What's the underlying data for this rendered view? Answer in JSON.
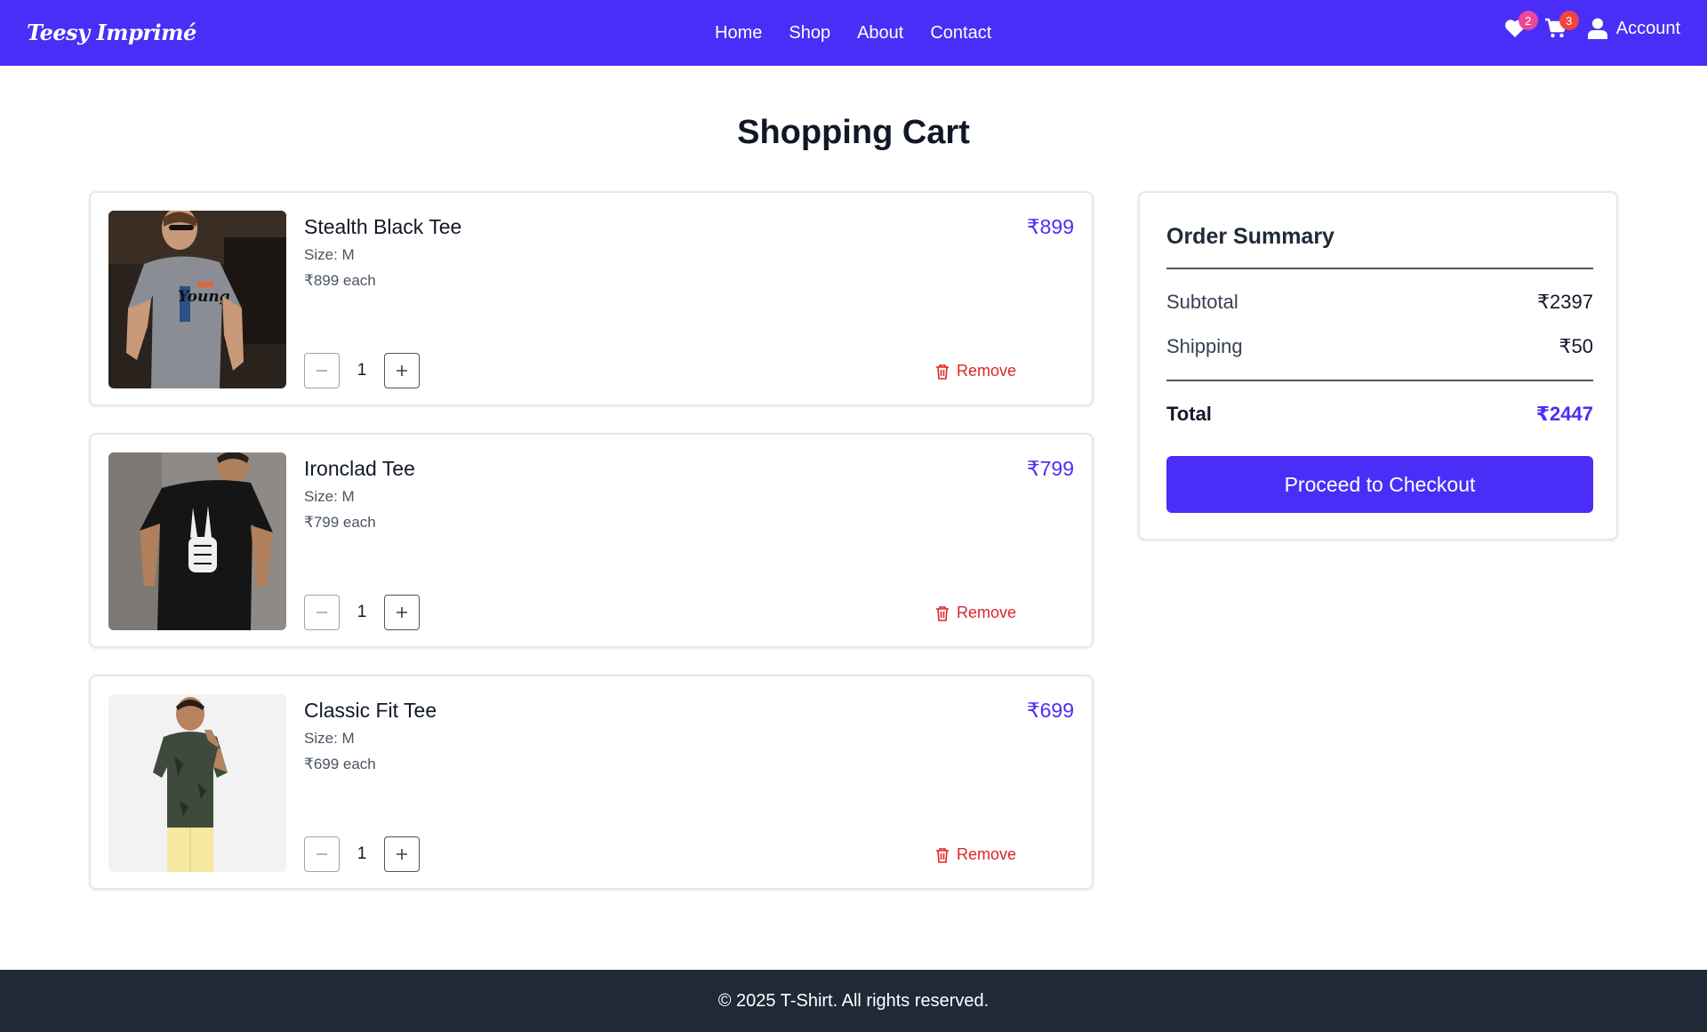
{
  "brand": "Teesy Imprimé",
  "nav": {
    "links": [
      "Home",
      "Shop",
      "About",
      "Contact"
    ]
  },
  "header_icons": {
    "wishlist_icon": "heart-icon",
    "wishlist_count": "2",
    "cart_icon": "cart-icon",
    "cart_count": "3",
    "account_icon": "user-icon",
    "account_label": "Account"
  },
  "page_title": "Shopping Cart",
  "cart_items": [
    {
      "name": "Stealth Black Tee",
      "size": "Size: M",
      "each": "₹899 each",
      "price": "₹899",
      "quantity": "1",
      "remove_label": "Remove"
    },
    {
      "name": "Ironclad Tee",
      "size": "Size: M",
      "each": "₹799 each",
      "price": "₹799",
      "quantity": "1",
      "remove_label": "Remove"
    },
    {
      "name": "Classic Fit Tee",
      "size": "Size: M",
      "each": "₹699 each",
      "price": "₹699",
      "quantity": "1",
      "remove_label": "Remove"
    }
  ],
  "summary": {
    "title": "Order Summary",
    "subtotal_label": "Subtotal",
    "subtotal_value": "₹2397",
    "shipping_label": "Shipping",
    "shipping_value": "₹50",
    "total_label": "Total",
    "total_value": "₹2447",
    "checkout_label": "Proceed to Checkout"
  },
  "footer": {
    "text": "© 2025 T-Shirt. All rights reserved."
  },
  "colors": {
    "accent": "#4a2ef7",
    "remove": "#dc2626",
    "footer_bg": "#1f2937",
    "badge_wishlist": "#ec4899",
    "badge_cart": "#ef4444"
  }
}
